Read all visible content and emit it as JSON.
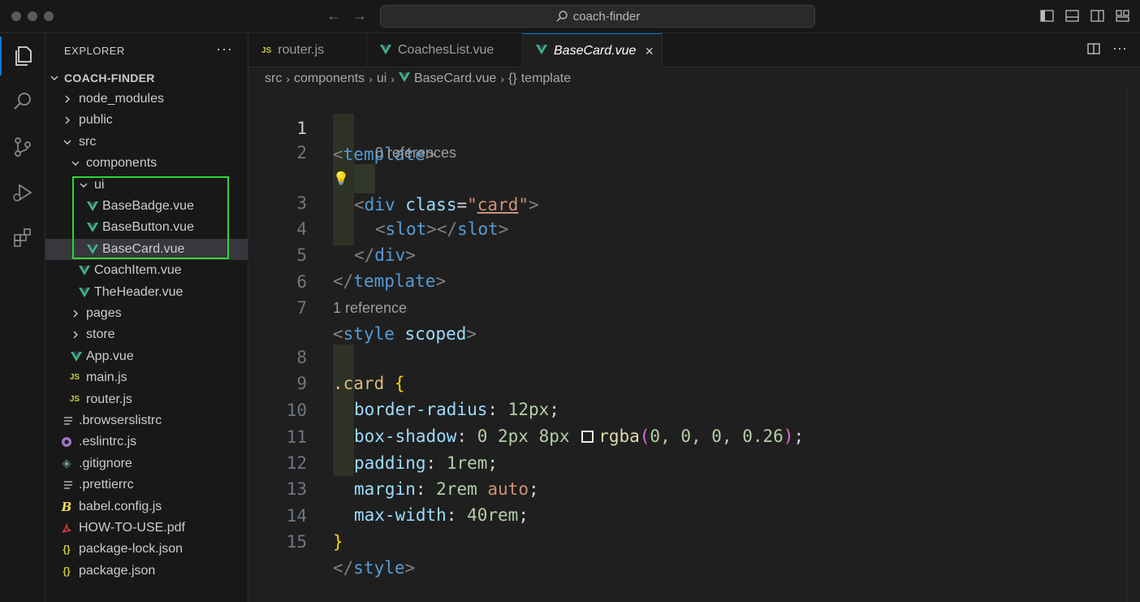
{
  "title_bar": {
    "search_text": "coach-finder",
    "back_icon": "arrow-left-icon",
    "forward_icon": "arrow-right-icon",
    "layout_icons": [
      "toggle-primary-sidebar-icon",
      "toggle-panel-icon",
      "toggle-secondary-sidebar-icon",
      "customize-layout-icon"
    ]
  },
  "activity_bar": {
    "items": [
      "explorer-icon",
      "search-icon",
      "source-control-icon",
      "run-debug-icon",
      "extensions-icon"
    ]
  },
  "explorer": {
    "title": "EXPLORER",
    "more": "···",
    "root": "COACH-FINDER",
    "items": [
      {
        "label": "node_modules",
        "type": "folder",
        "expanded": false
      },
      {
        "label": "public",
        "type": "folder",
        "expanded": false
      },
      {
        "label": "src",
        "type": "folder",
        "expanded": true
      },
      {
        "label": "components",
        "type": "folder",
        "expanded": true
      },
      {
        "label": "ui",
        "type": "folder",
        "expanded": true
      },
      {
        "label": "BaseBadge.vue",
        "type": "vue"
      },
      {
        "label": "BaseButton.vue",
        "type": "vue"
      },
      {
        "label": "BaseCard.vue",
        "type": "vue",
        "selected": true
      },
      {
        "label": "CoachItem.vue",
        "type": "vue"
      },
      {
        "label": "TheHeader.vue",
        "type": "vue"
      },
      {
        "label": "pages",
        "type": "folder",
        "expanded": false
      },
      {
        "label": "store",
        "type": "folder",
        "expanded": false
      },
      {
        "label": "App.vue",
        "type": "vue"
      },
      {
        "label": "main.js",
        "type": "js"
      },
      {
        "label": "router.js",
        "type": "js"
      },
      {
        "label": ".browserslistrc",
        "type": "config"
      },
      {
        "label": ".eslintrc.js",
        "type": "eslint"
      },
      {
        "label": ".gitignore",
        "type": "git"
      },
      {
        "label": ".prettierrc",
        "type": "config"
      },
      {
        "label": "babel.config.js",
        "type": "babel"
      },
      {
        "label": "HOW-TO-USE.pdf",
        "type": "pdf"
      },
      {
        "label": "package-lock.json",
        "type": "json"
      },
      {
        "label": "package.json",
        "type": "json"
      }
    ]
  },
  "tabs": [
    {
      "label": "router.js",
      "icon": "JS"
    },
    {
      "label": "CoachesList.vue",
      "icon": "vue"
    },
    {
      "label": "BaseCard.vue",
      "icon": "vue",
      "active": true
    }
  ],
  "breadcrumb": [
    "src",
    "components",
    "ui",
    "BaseCard.vue",
    "template"
  ],
  "breadcrumb_braces": "{}",
  "codelens": {
    "line2": "0 references",
    "line7": "1 reference"
  },
  "code": {
    "line_numbers": [
      "1",
      "2",
      "3",
      "4",
      "5",
      "6",
      "7",
      "8",
      "9",
      "10",
      "11",
      "12",
      "13",
      "14",
      "15"
    ],
    "l1_tag": "template",
    "l2_tag": "div",
    "l2_attr": "class",
    "l2_val": "card",
    "l3_tag": "slot",
    "l4_tag": "div",
    "l5_tag": "template",
    "l7_tag": "style",
    "l7_attr": "scoped",
    "l8_sel": ".card",
    "l9_prop": "border-radius",
    "l9_val": "12px",
    "l10_prop": "box-shadow",
    "l10_vals": "0 2px 8px",
    "l10_fn": "rgba",
    "l10_args": "0, 0, 0, 0.26",
    "l11_prop": "padding",
    "l11_val": "1rem",
    "l12_prop": "margin",
    "l12_val": "2rem",
    "l12_kw": "auto",
    "l13_prop": "max-width",
    "l13_val": "40rem",
    "l15_tag": "style"
  },
  "colors": {
    "accent": "#0078d4",
    "vue_green": "#41b883",
    "js_yellow": "#cbcb41",
    "highlight_box": "#2fd52f"
  }
}
